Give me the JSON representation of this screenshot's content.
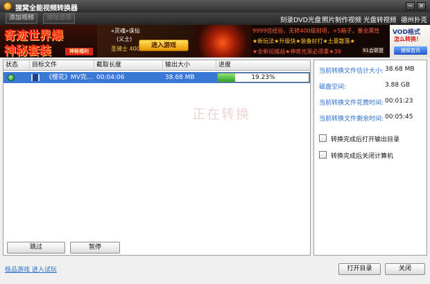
{
  "window": {
    "title": "狸窝全能视频转换器",
    "icon": "app-logo-icon",
    "minimize_glyph": "−",
    "close_glyph": "×"
  },
  "toolbar": {
    "add_video": "添加视频",
    "remove_selected": "清除选择",
    "links": [
      "刻录DVD光盘",
      "照片制作视频",
      "光盘转视频",
      "德州扑克"
    ]
  },
  "banner": {
    "left_line1": "奇迹世界爆",
    "left_line2": "神秘套装",
    "left_tag": "神秘福利",
    "mid_line1": "«灵魂»诛仙",
    "mid_line2": "(义士)",
    "mid_line3": "圣骑士 400",
    "enter_game": "进入游戏",
    "right_line1": "9999倍经验，无转400级刻项，+5箱子，暴全属性",
    "right_line2": "★新玩法★升级快★装备好打★土豪散落★",
    "right_line3": "★全新玩城战★神奇光渐必须拿★39",
    "league": "91会联盟",
    "vod_title": "VOD格式",
    "vod_sub": "怎么转换！",
    "vod_home": "狸窝首页"
  },
  "table": {
    "columns": [
      "状态",
      "目标文件",
      "截取长度",
      "输出大小",
      "进度"
    ],
    "rows": [
      {
        "status_icon": "globe-icon",
        "file_icon": "film-icon",
        "file": "《樱花》MV完…",
        "duration": "00:04:06",
        "size": "38.68 MB",
        "progress": 0.1923,
        "progress_text": "19.23%"
      }
    ]
  },
  "watermark": "正在转换",
  "buttons": {
    "skip": "跳过",
    "pause": "暂停",
    "open_dir": "打开目录",
    "close": "关闭"
  },
  "info": {
    "est_size_label": "当前转换文件估计大小:",
    "est_size_value": "38.68 MB",
    "disk_label": "磁盘空间:",
    "disk_value": "3.88 GB",
    "elapsed_label": "当前转换文件花费时间:",
    "elapsed_value": "00:01:23",
    "remaining_label": "当前转换文件剩余时间:",
    "remaining_value": "00:05:45"
  },
  "options": {
    "open_output_label": "转换完成后打开输出目录",
    "open_output_checked": false,
    "shutdown_label": "转换完成后关闭计算机",
    "shutdown_checked": false
  },
  "footer": {
    "ad_link": "极品游戏 进入试玩"
  },
  "colors": {
    "selection": "#3a78d6",
    "link": "#2a6fc9",
    "progress": "#2f9f22"
  }
}
